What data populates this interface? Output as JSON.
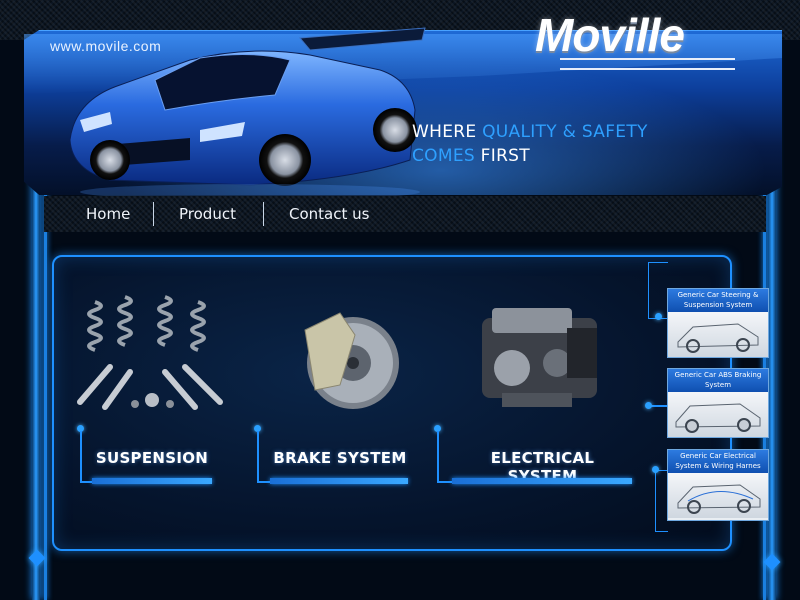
{
  "site": {
    "url": "www.movile.com",
    "logo": "Moville"
  },
  "tagline": {
    "line1_a": "WHERE",
    "line1_b": "QUALITY & SAFETY",
    "line2_a": "COMES",
    "line2_b": "FIRST"
  },
  "nav": {
    "items": [
      {
        "label": "Home"
      },
      {
        "label": "Product"
      },
      {
        "label": "Contact us"
      }
    ]
  },
  "products": [
    {
      "label": "SUSPENSION",
      "icon": "suspension-springs-icon"
    },
    {
      "label": "BRAKE SYSTEM",
      "icon": "brake-disc-icon"
    },
    {
      "label": "ELECTRICAL SYSTEM",
      "icon": "engine-icon"
    }
  ],
  "side_cards": [
    {
      "title": "Generic Car Steering & Suspension System",
      "icon": "car-chassis-icon"
    },
    {
      "title": "Generic Car ABS Braking System",
      "icon": "car-abs-icon"
    },
    {
      "title": "Generic Car Electrical System & Wiring Harnes",
      "icon": "car-wiring-icon"
    }
  ],
  "colors": {
    "accent": "#1e90ff",
    "tagline_blue": "#2ea0ff",
    "background": "#020a16"
  }
}
